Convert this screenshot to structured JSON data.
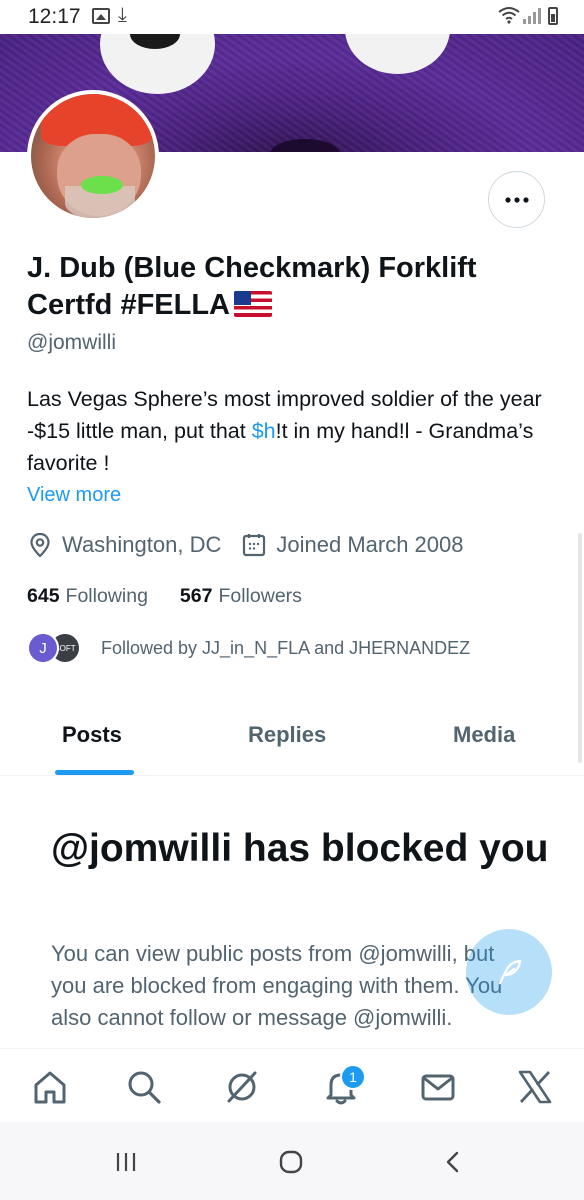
{
  "status_bar": {
    "time": "12:17"
  },
  "profile": {
    "display_name": "J. Dub (Blue Checkmark) Forklift Certfd #FELLA",
    "handle": "@jomwilli",
    "bio_part1": "Las Vegas Sphere’s most improved soldier of the year -$15 little man, put that ",
    "bio_cashtag": "$h",
    "bio_part2": "!t in my hand!l - Grandma’s favorite !",
    "view_more": "View more",
    "location": "Washington, DC",
    "joined": "Joined March 2008",
    "following_count": "645",
    "following_label": "Following",
    "followers_count": "567",
    "followers_label": "Followers",
    "followed_by": "Followed by JJ_in_N_FLA and JHERNANDEZ",
    "mini_avatar_letter": "J",
    "mini_avatar2_text": "SOFT"
  },
  "tabs": [
    {
      "label": "Posts",
      "active": true
    },
    {
      "label": "Replies",
      "active": false
    },
    {
      "label": "Media",
      "active": false
    }
  ],
  "blocked": {
    "title": "@jomwilli has blocked you",
    "body": "You can view public posts from @jomwilli, but you are blocked from engaging with them. You also cannot follow or message @jomwilli."
  },
  "bottom_nav": {
    "items": [
      "home-icon",
      "search-icon",
      "grok-icon",
      "notifications-icon",
      "messages-icon",
      "x-icon"
    ],
    "notification_badge": "1"
  },
  "colors": {
    "accent": "#1d9bf0",
    "text": "#0f1419",
    "secondary": "#536471"
  }
}
